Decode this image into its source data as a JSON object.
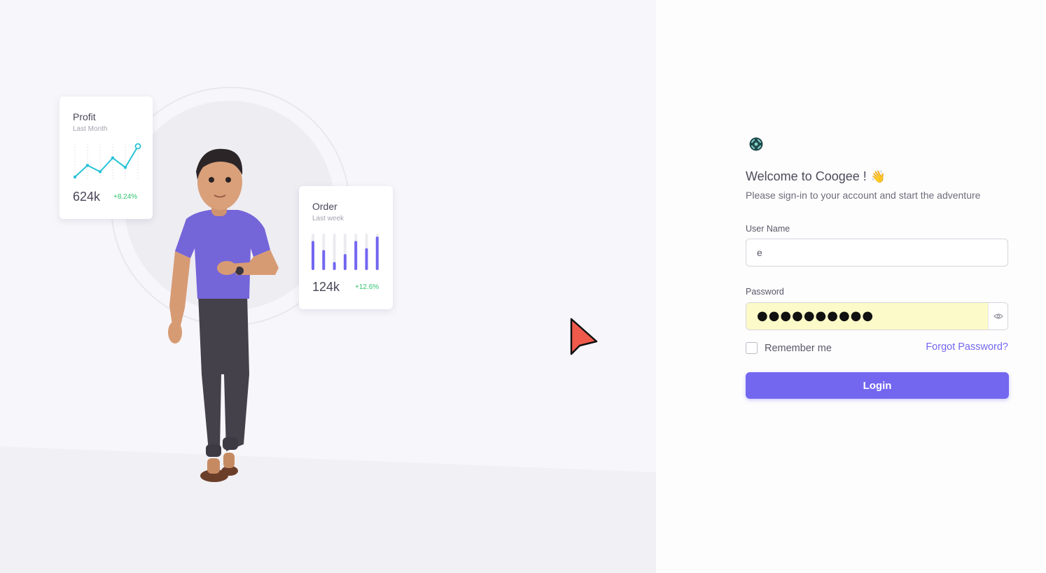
{
  "illustration": {
    "profit_card": {
      "title": "Profit",
      "subtitle": "Last Month",
      "value": "624k",
      "delta": "+8.24%",
      "sparkline": [
        0,
        0.55,
        0.25,
        0.9,
        0.45,
        1.45
      ],
      "line_color": "#28c3d7"
    },
    "order_card": {
      "title": "Order",
      "subtitle": "Last week",
      "value": "124k",
      "delta": "+12.6%",
      "bars": [
        0.8,
        0.55,
        0.22,
        0.44,
        0.8,
        0.6,
        0.92
      ],
      "bar_color": "#7367f0"
    }
  },
  "auth": {
    "logo_icon": "logo-icon",
    "welcome": "Welcome to Coogee !",
    "welcome_emoji": "👋",
    "subtitle": "Please sign-in to your account and start the adventure",
    "username_label": "User Name",
    "username_value": "e",
    "password_label": "Password",
    "password_masked": "●●●●●●●●●●",
    "password_toggle_icon": "eye-icon",
    "remember_label": "Remember me",
    "remember_checked": false,
    "forgot_label": "Forgot Password?",
    "login_label": "Login"
  },
  "colors": {
    "primary": "#7367f0",
    "success": "#2fc46f",
    "autofill_bg": "#fcfac8",
    "left_bg": "#f7f6fa"
  }
}
